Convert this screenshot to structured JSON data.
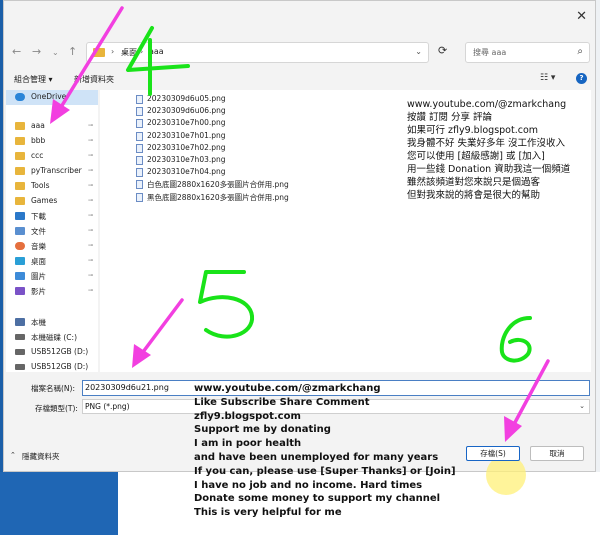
{
  "dialog": {
    "close_glyph": "✕",
    "nav": {
      "back": "←",
      "forward": "→",
      "recent": "⌄",
      "up": "↑",
      "refresh": "⟳"
    },
    "address": {
      "crumbs": [
        "桌面",
        "aaa"
      ],
      "sep": "›",
      "dropdown": "⌄"
    },
    "search": {
      "placeholder": "搜尋 aaa",
      "icon": "⌕"
    },
    "toolbar": {
      "organize": "組合管理 ▾",
      "new_folder": "新增資料夾",
      "view_glyph": "☷ ▾",
      "help_glyph": "?"
    },
    "navpane": {
      "items": [
        {
          "label": "OneDrive",
          "icon": "onedrive-icon",
          "selected": true
        },
        {
          "label": "aaa",
          "icon": "folder-icon",
          "pin": true
        },
        {
          "label": "bbb",
          "icon": "folder-icon",
          "pin": true
        },
        {
          "label": "ccc",
          "icon": "folder-icon",
          "pin": true
        },
        {
          "label": "pyTranscriber",
          "icon": "folder-icon",
          "pin": true
        },
        {
          "label": "Tools",
          "icon": "folder-icon",
          "pin": true
        },
        {
          "label": "Games",
          "icon": "folder-icon",
          "pin": true
        },
        {
          "label": "下載",
          "icon": "download-icon",
          "pin": true
        },
        {
          "label": "文件",
          "icon": "documents-icon",
          "pin": true
        },
        {
          "label": "音樂",
          "icon": "music-icon",
          "pin": true
        },
        {
          "label": "桌面",
          "icon": "desktop-icon",
          "pin": true
        },
        {
          "label": "圖片",
          "icon": "pictures-icon",
          "pin": true
        },
        {
          "label": "影片",
          "icon": "videos-icon",
          "pin": true
        },
        {
          "label": "本機",
          "icon": "pc-icon"
        },
        {
          "label": "本機磁碟 (C:)",
          "icon": "drive-icon"
        },
        {
          "label": "USB512GB (D:)",
          "icon": "drive-icon"
        },
        {
          "label": "USB512GB (D:)",
          "icon": "drive-icon"
        }
      ],
      "pin_glyph": "📌"
    },
    "files": [
      "20230309d6u05.png",
      "20230309d6u06.png",
      "20230310e7h00.png",
      "20230310e7h01.png",
      "20230310e7h02.png",
      "20230310e7h03.png",
      "20230310e7h04.png",
      "白色底圖2880x1620多張圖片合併用.png",
      "黑色底圖2880x1620多張圖片合併用.png"
    ],
    "overlay_lines": [
      "www.youtube.com/@zmarkchang",
      "按讚 訂閱 分享 評論",
      "如果可行 zfly9.blogspot.com",
      "我身體不好 失業好多年 沒工作沒收入",
      "您可以使用 [超級感謝] 或 [加入]",
      "用一些錢 Donation 資助我這一個頻道",
      "雖然該頻道對您來說只是個過客",
      "但對我來說的將會是很大的幫助"
    ],
    "form": {
      "filename_label": "檔案名稱(N):",
      "filename_value": "20230309d6u21.png",
      "filetype_label": "存檔類型(T):",
      "filetype_value": "PNG (*.png)",
      "dropdown_glyph": "⌄"
    },
    "buttons": {
      "save": "存檔(S)",
      "cancel": "取消",
      "hide_folders": "隱藏資料夾",
      "hide_chev": "⌃"
    },
    "bottom_overlay_lines": [
      "www.youtube.com/@zmarkchang",
      "Like Subscribe Share Comment",
      "zfly9.blogspot.com",
      "Support me by donating",
      "I am in poor health",
      "and have been unemployed for many years",
      "If you can, please use [Super Thanks] or [Join]",
      "I have no job and no income. Hard times",
      "Donate some money to support my channel",
      "This is very helpful for me"
    ]
  },
  "annotations": {
    "numbers": [
      "4",
      "5",
      "6"
    ],
    "number_color": "#19e319",
    "arrow_color": "#f23fe0"
  }
}
